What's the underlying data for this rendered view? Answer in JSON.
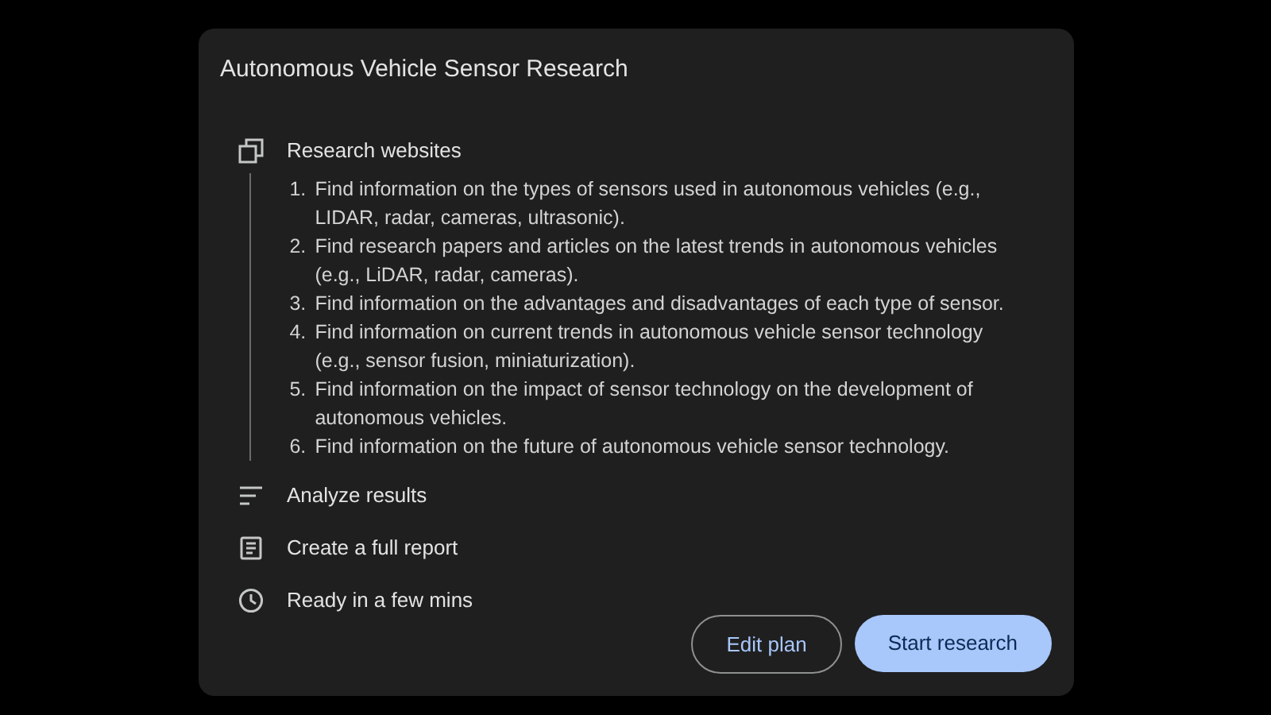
{
  "title": "Autonomous Vehicle Sensor Research",
  "steps": [
    {
      "kind": "websites",
      "label": "Research websites",
      "items": [
        {
          "number": "1.",
          "text": "Find information on the types of sensors used in autonomous vehicles (e.g., LIDAR, radar, cameras, ultrasonic)."
        },
        {
          "number": "2.",
          "text": "Find research papers and articles on the latest trends in autonomous vehicles (e.g., LiDAR, radar, cameras)."
        },
        {
          "number": "3.",
          "text": "Find information on the advantages and disadvantages of each type of sensor."
        },
        {
          "number": "4.",
          "text": "Find information on current trends in autonomous vehicle sensor technology (e.g., sensor fusion, miniaturization)."
        },
        {
          "number": "5.",
          "text": "Find information on the impact of sensor technology on the development of autonomous vehicles."
        },
        {
          "number": "6.",
          "text": "Find information on the future of autonomous vehicle sensor technology."
        }
      ]
    },
    {
      "kind": "analyze",
      "label": "Analyze results"
    },
    {
      "kind": "report",
      "label": "Create a full report"
    },
    {
      "kind": "time",
      "label": "Ready in a few mins"
    }
  ],
  "buttons": [
    {
      "kind": "outline",
      "label": "Edit plan"
    },
    {
      "kind": "filled",
      "label": "Start research"
    }
  ]
}
